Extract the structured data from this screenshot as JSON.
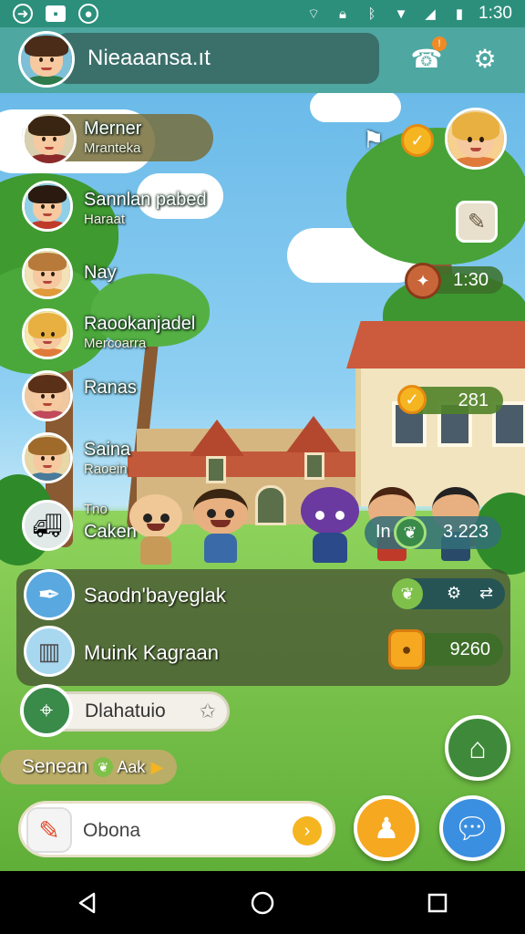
{
  "status_bar": {
    "time": "1:30",
    "left_icons": [
      "app-icon",
      "image-icon",
      "game-icon"
    ],
    "right_icons": [
      "wifi-icon",
      "lock-icon",
      "bluetooth-icon",
      "signal-icon",
      "battery-icon"
    ]
  },
  "header": {
    "player_name": "Nieaaansa.ıt",
    "notification_icon": "phone-notification-icon",
    "settings_icon": "gear-icon"
  },
  "players": [
    {
      "name": "Merner",
      "sub": "Mranteka"
    },
    {
      "name": "Sannlan pabed",
      "sub": "Haraat"
    },
    {
      "name": "Nay",
      "sub": ""
    },
    {
      "name": "Raookanjadel",
      "sub": "Mercoarra"
    },
    {
      "name": "Ranas",
      "sub": ""
    },
    {
      "name": "Saina",
      "sub": "Raoein"
    },
    {
      "name": "Caken",
      "sub": "Tno"
    }
  ],
  "hud": {
    "timer": "1:30",
    "counter": "281",
    "score_prefix": "In",
    "score": "3.223",
    "reward": "9260"
  },
  "missions": [
    {
      "label": "Saodn'bayeglak"
    },
    {
      "label": "Muink Kagraan"
    }
  ],
  "chips": {
    "search_label": "Dlahatuio",
    "promo_label": "Senean",
    "promo_extra": "Aak"
  },
  "input": {
    "placeholder": "Obona"
  },
  "colors": {
    "status_bar": "#2c8f7c",
    "header": "#4ea7a1",
    "accent_orange": "#f5a820",
    "accent_blue": "#3b8fe0",
    "accent_green": "#3f8a3a"
  }
}
